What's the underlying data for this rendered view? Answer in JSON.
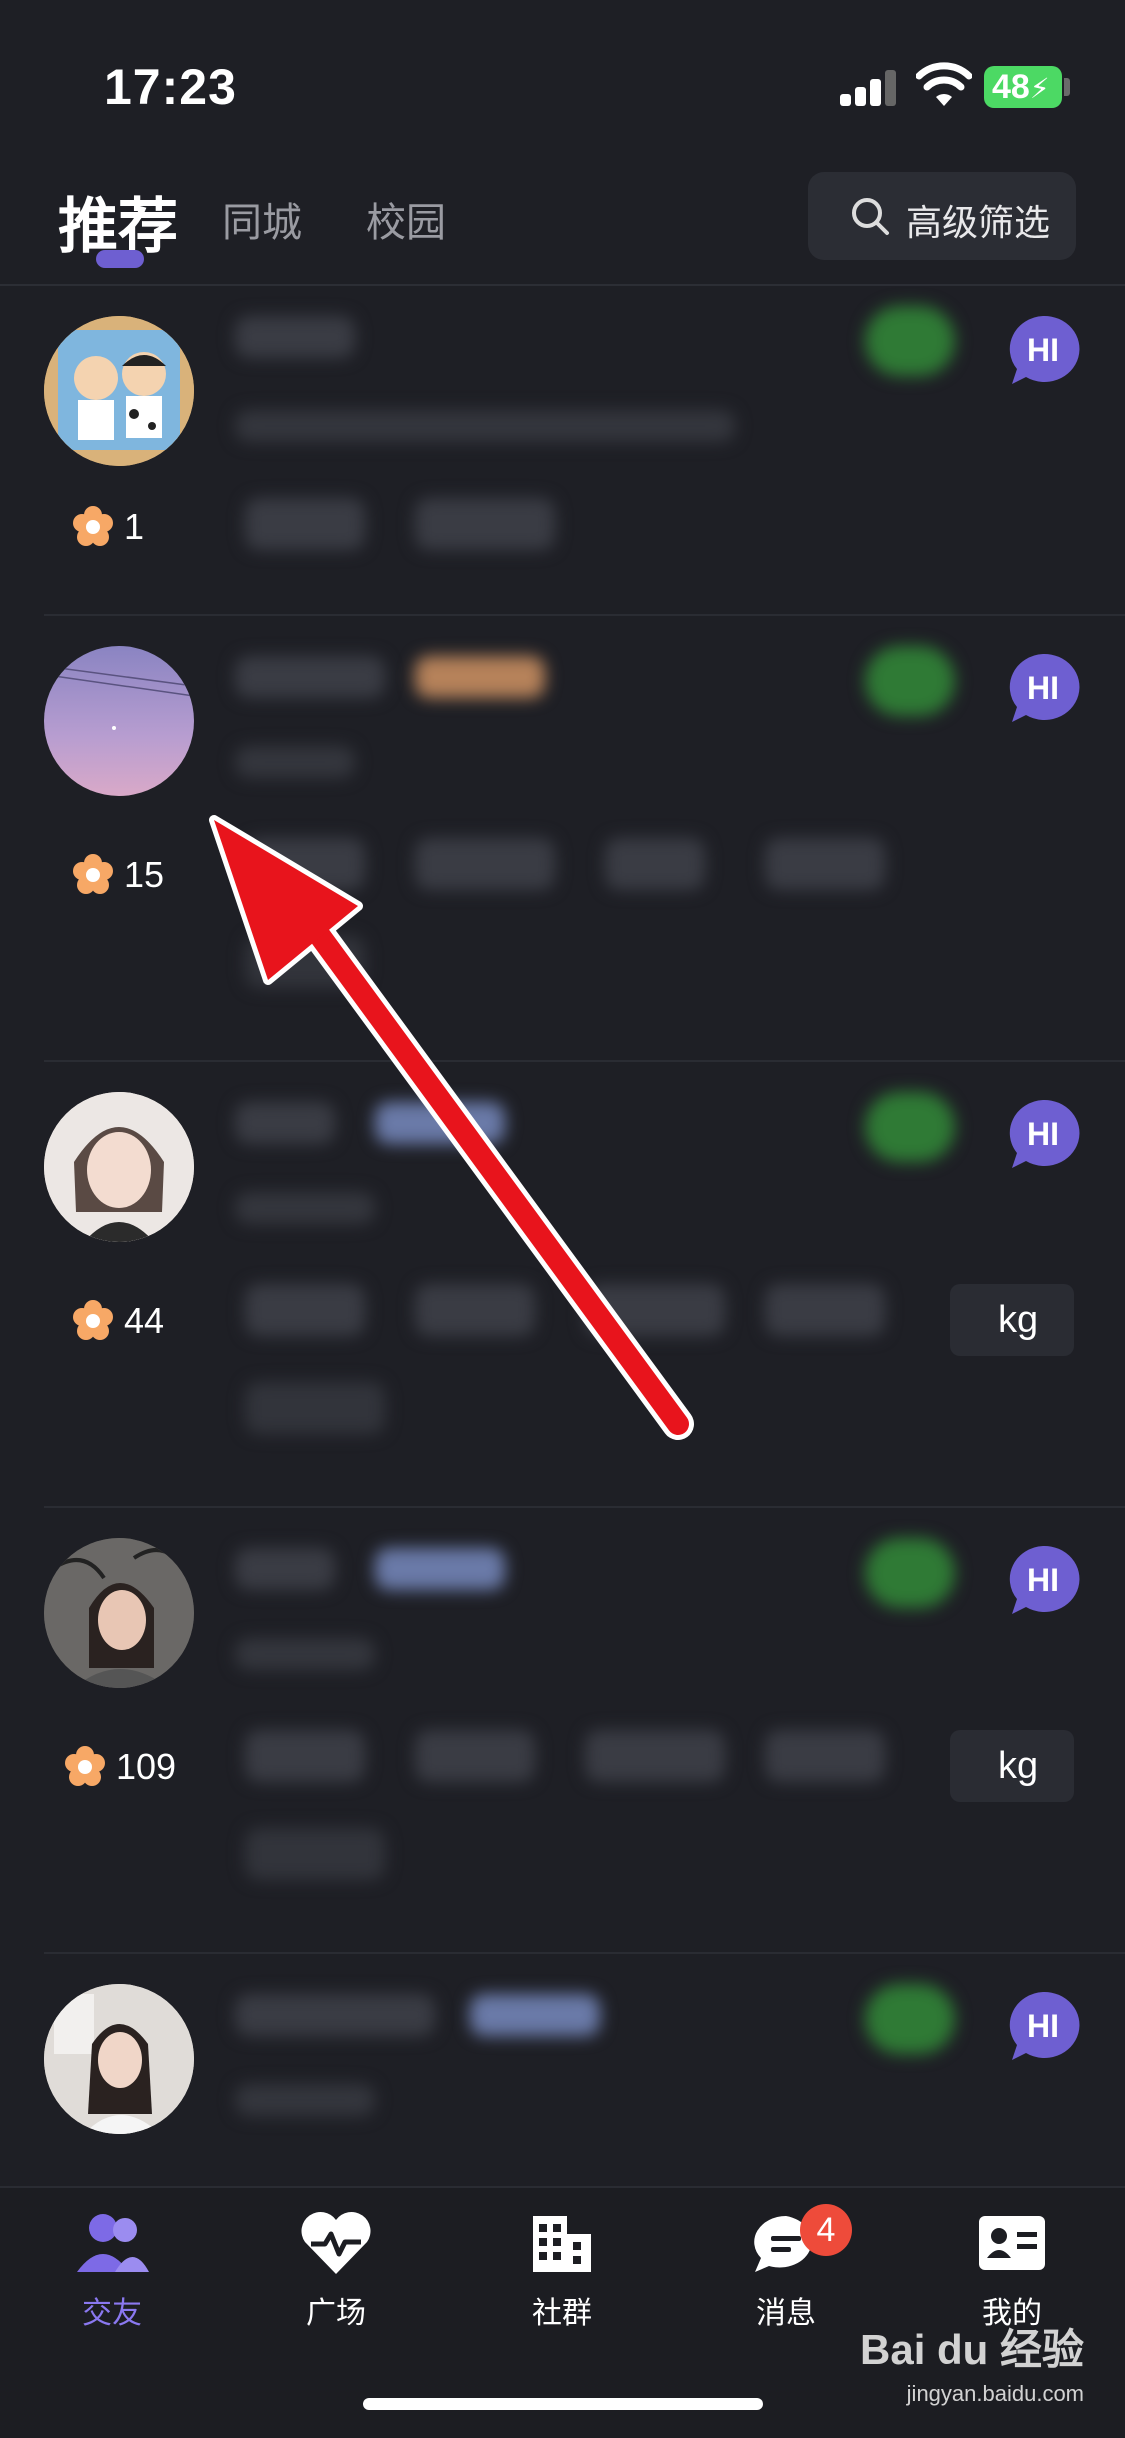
{
  "status_bar": {
    "time": "17:23",
    "battery": "48"
  },
  "tabs": {
    "items": [
      {
        "label": "推荐"
      },
      {
        "label": "同城"
      },
      {
        "label": "校园"
      }
    ],
    "filter_label": "高级筛选"
  },
  "cards": [
    {
      "score": "1",
      "avatar": "cartoon-duo-avatar"
    },
    {
      "score": "15",
      "avatar": "purple-sky-avatar"
    },
    {
      "score": "44",
      "avatar": "girl-portrait-avatar",
      "extra_chip": "kg"
    },
    {
      "score": "109",
      "avatar": "girl-curly-avatar",
      "extra_chip": "kg"
    },
    {
      "score": "",
      "avatar": "girl-room-avatar"
    }
  ],
  "tabbar": {
    "items": [
      {
        "label": "交友",
        "icon": "friends-icon",
        "active": true
      },
      {
        "label": "广场",
        "icon": "heartbeat-icon"
      },
      {
        "label": "社群",
        "icon": "building-icon"
      },
      {
        "label": "消息",
        "icon": "chat-icon",
        "badge": "4"
      },
      {
        "label": "我的",
        "icon": "profile-card-icon"
      }
    ]
  },
  "watermark": {
    "brand": "Bai du 经验",
    "url": "jingyan.baidu.com"
  },
  "colors": {
    "accent": "#6e5fd1",
    "background": "#1e1f25",
    "arrow": "#e8141c",
    "badge": "#ee4b3a"
  }
}
